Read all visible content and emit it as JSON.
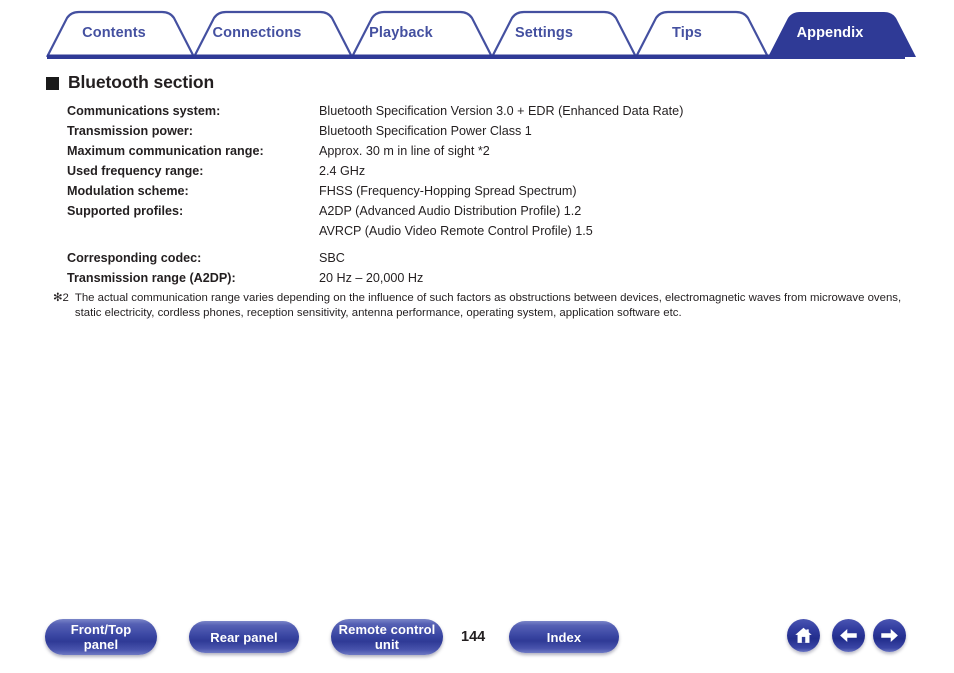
{
  "tabs": [
    {
      "label": "Contents",
      "active": false
    },
    {
      "label": "Connections",
      "active": false
    },
    {
      "label": "Playback",
      "active": false
    },
    {
      "label": "Settings",
      "active": false
    },
    {
      "label": "Tips",
      "active": false
    },
    {
      "label": "Appendix",
      "active": true
    }
  ],
  "section": {
    "title": "Bluetooth section"
  },
  "specs": [
    {
      "label": "Communications system:",
      "value": "Bluetooth Specification Version 3.0 + EDR (Enhanced Data Rate)",
      "value2": ""
    },
    {
      "label": "Transmission power:",
      "value": "Bluetooth Specification Power Class 1",
      "value2": ""
    },
    {
      "label": "Maximum communication range:",
      "value": "Approx. 30 m in line of sight *2",
      "value2": ""
    },
    {
      "label": "Used frequency range:",
      "value": "2.4 GHz",
      "value2": ""
    },
    {
      "label": "Modulation scheme:",
      "value": "FHSS (Frequency-Hopping Spread Spectrum)",
      "value2": ""
    },
    {
      "label": "Supported profiles:",
      "value": "A2DP (Advanced Audio Distribution Profile) 1.2",
      "value2": "AVRCP (Audio Video Remote Control Profile) 1.5"
    },
    {
      "label": "Corresponding codec:",
      "value": "SBC",
      "value2": ""
    },
    {
      "label": "Transmission range (A2DP):",
      "value": "20 Hz – 20,000 Hz",
      "value2": ""
    }
  ],
  "footnote": {
    "marker": "✻2",
    "text": "The actual communication range varies depending on the influence of such factors as obstructions between devices, electromagnetic waves from microwave ovens, static electricity, cordless phones, reception sensitivity, antenna performance, operating system, application software etc."
  },
  "footer": {
    "buttons": [
      {
        "label_line1": "Front/Top",
        "label_line2": "panel"
      },
      {
        "label_line1": "Rear panel",
        "label_line2": ""
      },
      {
        "label_line1": "Remote control",
        "label_line2": "unit"
      },
      {
        "label_line1": "Index",
        "label_line2": ""
      }
    ],
    "page_number": "144",
    "nav_icons": [
      "home-icon",
      "back-arrow-icon",
      "forward-arrow-icon"
    ]
  },
  "colors": {
    "accent_navy": "#2f3a96",
    "tab_outline": "#4450a0",
    "text": "#231f20"
  }
}
